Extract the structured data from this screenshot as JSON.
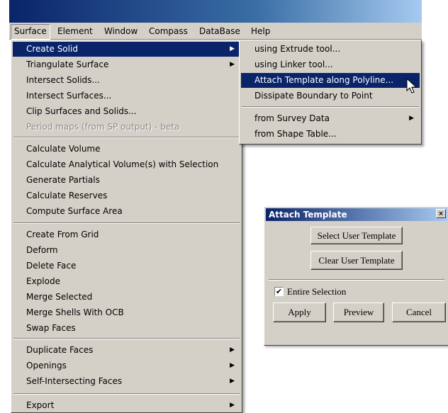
{
  "menubar": {
    "items": [
      "Surface",
      "Element",
      "Window",
      "Compass",
      "DataBase",
      "Help"
    ]
  },
  "surface_menu": {
    "groups": [
      [
        {
          "label": "Create Solid",
          "submenu": true,
          "highlighted": true
        },
        {
          "label": "Triangulate Surface",
          "submenu": true
        },
        {
          "label": "Intersect Solids..."
        },
        {
          "label": "Intersect Surfaces..."
        },
        {
          "label": "Clip Surfaces and Solids..."
        },
        {
          "label": "Period maps (from SP output) - beta",
          "disabled": true
        }
      ],
      [
        {
          "label": "Calculate Volume"
        },
        {
          "label": "Calculate Analytical Volume(s) with Selection"
        },
        {
          "label": "Generate Partials"
        },
        {
          "label": "Calculate Reserves"
        },
        {
          "label": "Compute Surface Area"
        }
      ],
      [
        {
          "label": "Create From Grid"
        },
        {
          "label": "Deform"
        },
        {
          "label": "Delete Face"
        },
        {
          "label": "Explode"
        },
        {
          "label": "Merge Selected"
        },
        {
          "label": "Merge Shells With OCB"
        },
        {
          "label": "Swap Faces"
        }
      ],
      [
        {
          "label": "Duplicate Faces",
          "submenu": true
        },
        {
          "label": "Openings",
          "submenu": true
        },
        {
          "label": "Self-Intersecting Faces",
          "submenu": true
        }
      ],
      [
        {
          "label": "Export",
          "submenu": true
        }
      ]
    ]
  },
  "create_solid_submenu": {
    "groups": [
      [
        {
          "label": "using Extrude tool..."
        },
        {
          "label": "using Linker tool..."
        },
        {
          "label": "Attach Template along Polyline...",
          "highlighted": true
        },
        {
          "label": "Dissipate Boundary to Point"
        }
      ],
      [
        {
          "label": "from Survey Data",
          "submenu": true
        },
        {
          "label": "from Shape Table..."
        }
      ]
    ]
  },
  "dialog": {
    "title": "Attach Template",
    "close_icon": "×",
    "select_template_label": "Select User Template",
    "clear_template_label": "Clear User Template",
    "entire_selection_label": "Entire Selection",
    "entire_selection_checked": true,
    "apply_label": "Apply",
    "preview_label": "Preview",
    "cancel_label": "Cancel"
  },
  "colors": {
    "menu_bg": "#d4d0c8",
    "highlight": "#0a246a",
    "title_gradient_start": "#0a246a"
  },
  "icons": {
    "submenu_arrow": "▶",
    "checkmark": "✔",
    "cursor": "arrow-pointer-icon"
  }
}
